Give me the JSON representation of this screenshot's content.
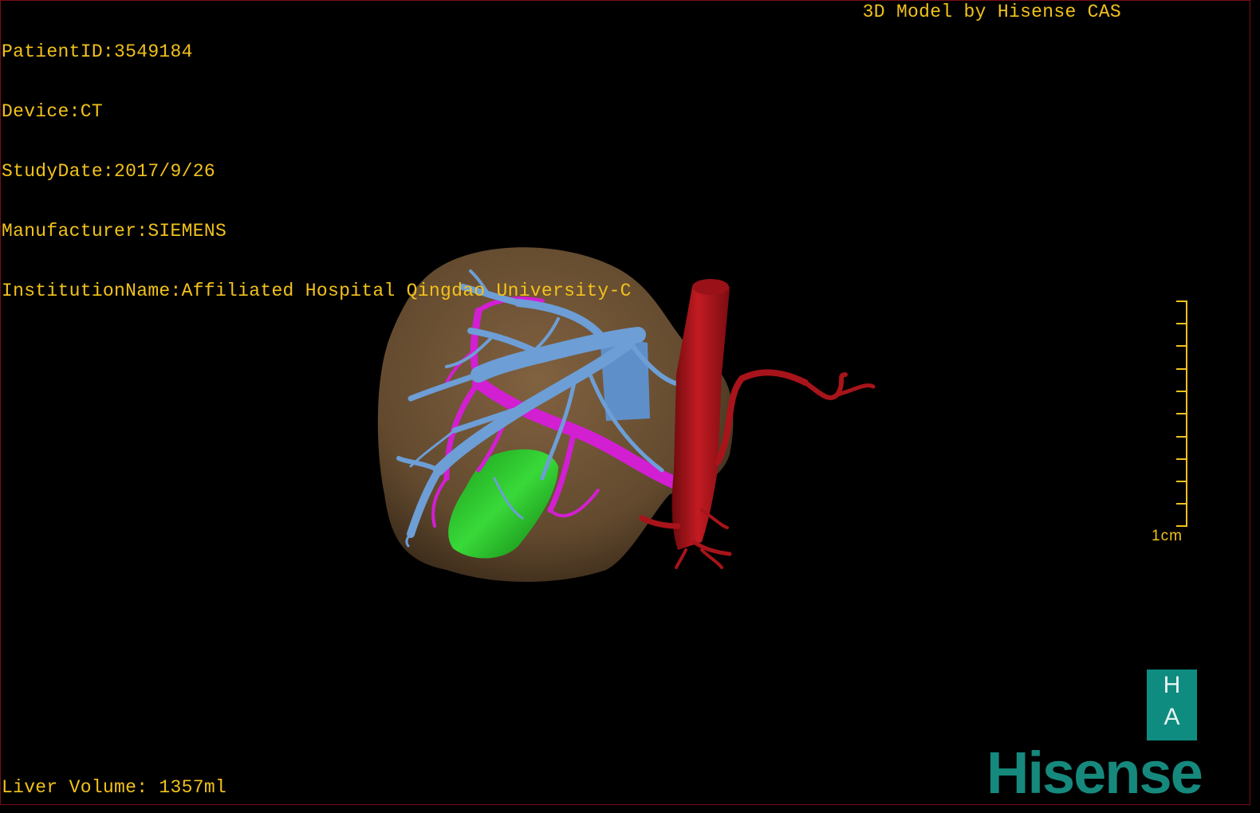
{
  "overlay": {
    "patient_id": "PatientID:3549184",
    "device": "Device:CT",
    "study_date": "StudyDate:2017/9/26",
    "manufacturer": "Manufacturer:SIEMENS",
    "institution": "InstitutionName:Affiliated Hospital Qingdao University-C",
    "brand_title": "3D Model by Hisense CAS",
    "liver_volume": "Liver Volume: 1357ml"
  },
  "scale": {
    "label": "1cm"
  },
  "logo": {
    "box_top": "H",
    "box_bottom": "A",
    "wordmark": "Hisense"
  },
  "colors": {
    "overlay_text": "#f2c21b",
    "liver": "#7a5c3c",
    "hepatic_vein": "#6d9ed6",
    "portal_vein": "#d21fd2",
    "gallbladder": "#16b816",
    "aorta": "#b3151b",
    "logo": "#16897d",
    "border": "#7a0d18"
  },
  "icons": [
    "liver-3d-model",
    "ha-logo-icon"
  ]
}
